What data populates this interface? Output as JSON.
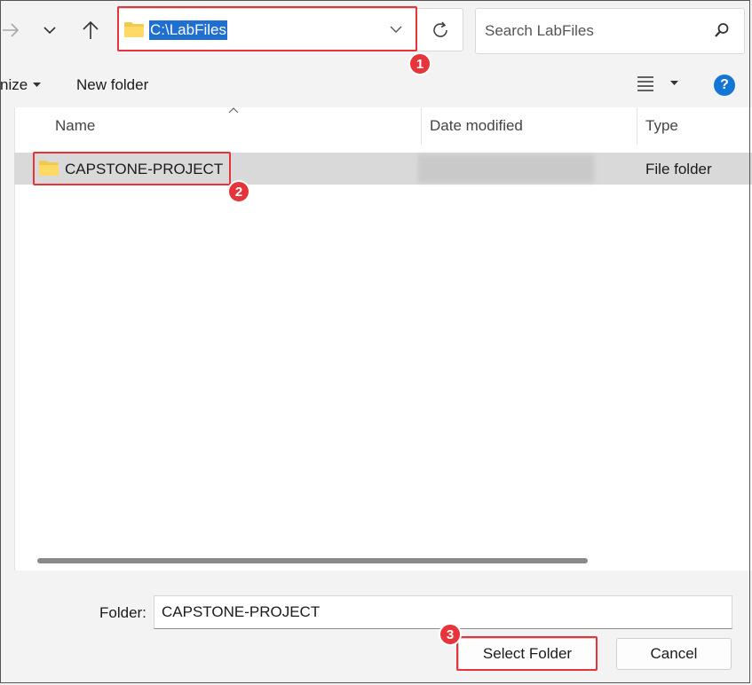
{
  "address": {
    "path": "C:\\LabFiles"
  },
  "search": {
    "placeholder": "Search LabFiles"
  },
  "toolbar": {
    "organize_label": "nize",
    "new_folder_label": "New folder",
    "help_label": "?"
  },
  "columns": {
    "name": "Name",
    "date_modified": "Date modified",
    "type": "Type"
  },
  "rows": [
    {
      "name": "CAPSTONE-PROJECT",
      "type": "File folder"
    }
  ],
  "bottom": {
    "folder_label": "Folder:",
    "folder_value": "CAPSTONE-PROJECT",
    "select_button": "Select Folder",
    "cancel_button": "Cancel"
  },
  "callouts": [
    "1",
    "2",
    "3"
  ],
  "colors": {
    "accent": "#1f6fd1",
    "callout": "#e5353a",
    "help": "#1476d4"
  }
}
